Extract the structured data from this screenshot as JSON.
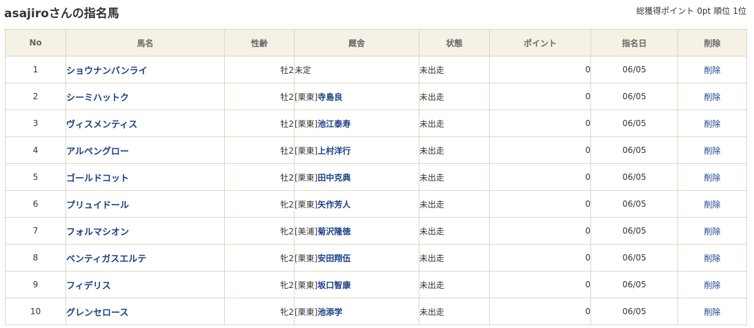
{
  "header": {
    "title": "asajiroさんの指名馬",
    "summary": {
      "points_label": "総獲得ポイント",
      "points_value": "0pt",
      "rank_label": "順位",
      "rank_value": "1位"
    }
  },
  "table": {
    "columns": {
      "no": "No",
      "name": "馬名",
      "sex_age": "性齢",
      "stable": "厩舎",
      "status": "状態",
      "point": "ポイント",
      "date": "指名日",
      "delete": "削除"
    },
    "rows": [
      {
        "no": "1",
        "name": "ショウナンバンライ",
        "sex_age": "牡2",
        "stable_loc": "",
        "stable_trainer": "未定",
        "status": "未出走",
        "point": "0",
        "date": "06/05",
        "delete": "削除"
      },
      {
        "no": "2",
        "name": "シーミハットク",
        "sex_age": "牡2",
        "stable_loc": "[栗東]",
        "stable_trainer": "寺島良",
        "status": "未出走",
        "point": "0",
        "date": "06/05",
        "delete": "削除"
      },
      {
        "no": "3",
        "name": "ヴィスメンティス",
        "sex_age": "牡2",
        "stable_loc": "[栗東]",
        "stable_trainer": "池江泰寿",
        "status": "未出走",
        "point": "0",
        "date": "06/05",
        "delete": "削除"
      },
      {
        "no": "4",
        "name": "アルペングロー",
        "sex_age": "牡2",
        "stable_loc": "[栗東]",
        "stable_trainer": "上村洋行",
        "status": "未出走",
        "point": "0",
        "date": "06/05",
        "delete": "削除"
      },
      {
        "no": "5",
        "name": "ゴールドコット",
        "sex_age": "牡2",
        "stable_loc": "[栗東]",
        "stable_trainer": "田中克典",
        "status": "未出走",
        "point": "0",
        "date": "06/05",
        "delete": "削除"
      },
      {
        "no": "6",
        "name": "プリュイドール",
        "sex_age": "牝2",
        "stable_loc": "[栗東]",
        "stable_trainer": "矢作芳人",
        "status": "未出走",
        "point": "0",
        "date": "06/05",
        "delete": "削除"
      },
      {
        "no": "7",
        "name": "フォルマシオン",
        "sex_age": "牝2",
        "stable_loc": "[美浦]",
        "stable_trainer": "菊沢隆徳",
        "status": "未出走",
        "point": "0",
        "date": "06/05",
        "delete": "削除"
      },
      {
        "no": "8",
        "name": "ベンティガスエルテ",
        "sex_age": "牝2",
        "stable_loc": "[栗東]",
        "stable_trainer": "安田翔伍",
        "status": "未出走",
        "point": "0",
        "date": "06/05",
        "delete": "削除"
      },
      {
        "no": "9",
        "name": "フィデリス",
        "sex_age": "牝2",
        "stable_loc": "[栗東]",
        "stable_trainer": "坂口智康",
        "status": "未出走",
        "point": "0",
        "date": "06/05",
        "delete": "削除"
      },
      {
        "no": "10",
        "name": "グレンセロース",
        "sex_age": "牝2",
        "stable_loc": "[栗東]",
        "stable_trainer": "池添学",
        "status": "未出走",
        "point": "0",
        "date": "06/05",
        "delete": "削除"
      }
    ]
  },
  "colors": {
    "link": "#1a3f86",
    "header_bg": "#f5f1e4",
    "border": "#dcd6c5"
  }
}
